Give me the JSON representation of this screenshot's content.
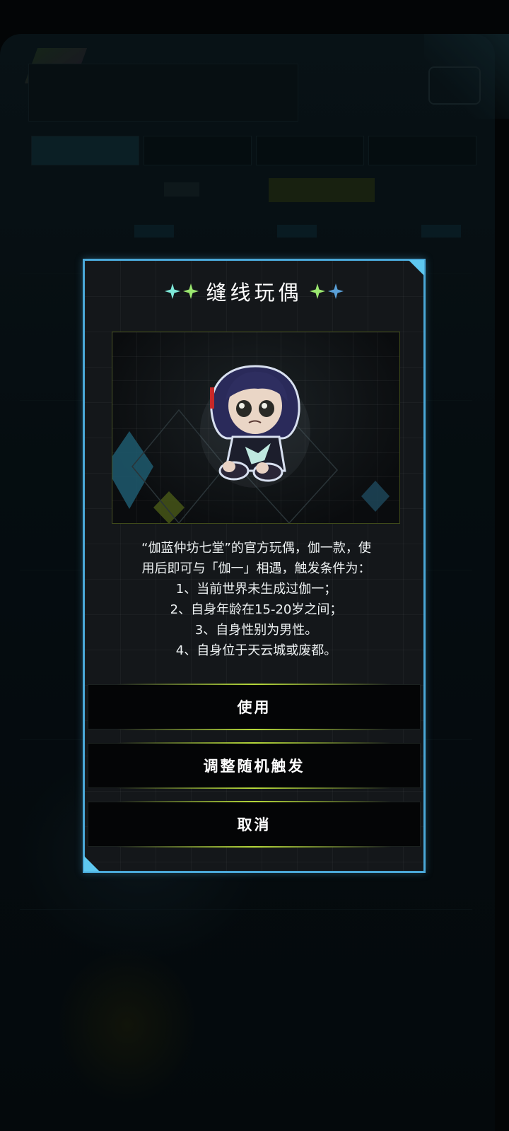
{
  "dialog": {
    "title": "缝线玩偶",
    "image_alt": "chibi doll",
    "description_lines": [
      "“伽蓝仲坊七堂”的官方玩偶，伽一款，使",
      "用后即可与「伽一」相遇，触发条件为：",
      "1、当前世界未生成过伽一；",
      "2、自身年龄在15-20岁之间；",
      "3、自身性别为男性。",
      "4、自身位于天云城或废都。"
    ],
    "buttons": {
      "use": "使用",
      "adjust": "调整随机触发",
      "cancel": "取消"
    },
    "colors": {
      "border": "#4aa8d8",
      "button_accent": "#b5d83a",
      "spark_teal": "#7ee8d8",
      "spark_green": "#9be870",
      "spark_blue": "#5aa0d8"
    }
  }
}
